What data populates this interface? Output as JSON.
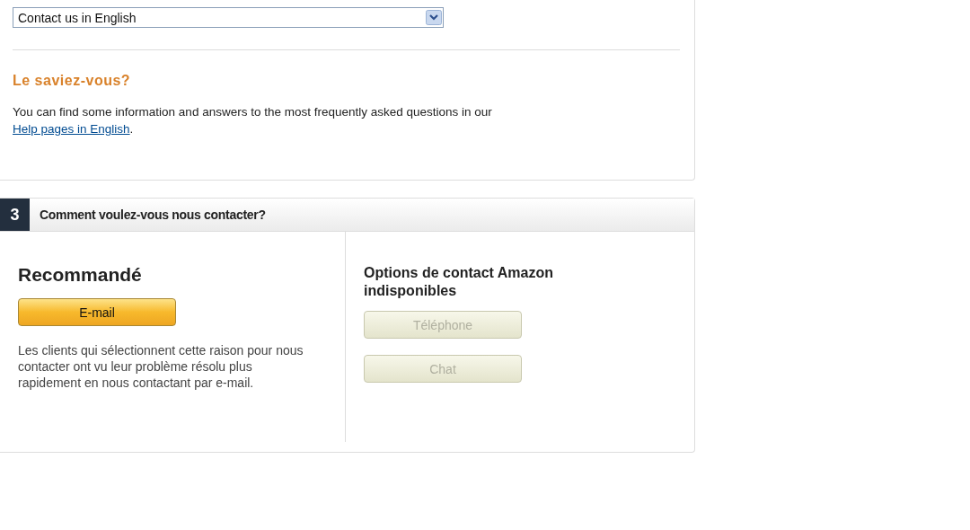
{
  "language_select": {
    "value": "Contact us in English"
  },
  "tip": {
    "title": "Le saviez-vous?",
    "text": "You can find some information and answers to the most frequently asked questions in our ",
    "link": "Help pages in English",
    "after": "."
  },
  "step": {
    "number": "3",
    "title": "Comment voulez-vous nous contacter?"
  },
  "recommended": {
    "title": "Recommandé",
    "buttons": [
      {
        "label": "E-mail",
        "disabled": false
      }
    ],
    "note": "Les clients qui sélectionnent cette raison pour nous contacter ont vu leur problème résolu plus rapidement en nous contactant par e-mail."
  },
  "unavailable": {
    "title": "Options de contact Amazon indisponibles",
    "buttons": [
      {
        "label": "Téléphone",
        "disabled": true
      },
      {
        "label": "Chat",
        "disabled": true
      }
    ]
  }
}
